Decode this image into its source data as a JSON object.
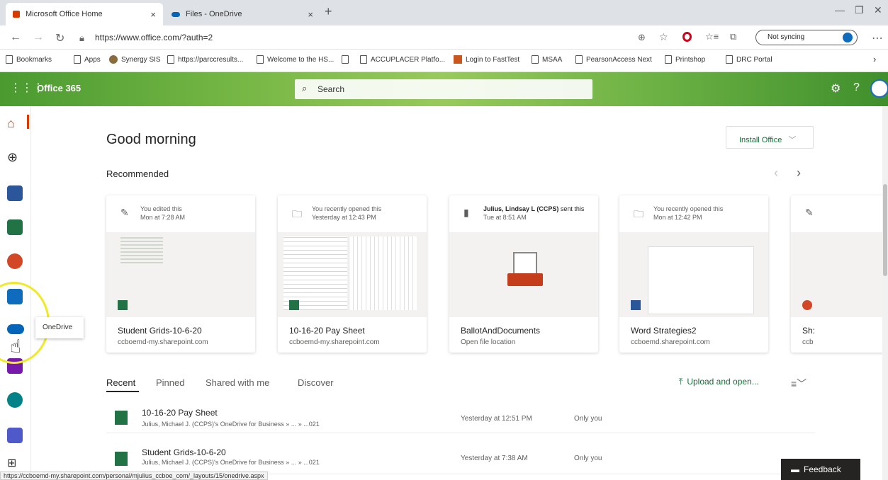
{
  "browser": {
    "tabs": [
      {
        "title": "Microsoft Office Home"
      },
      {
        "title": "Files - OneDrive"
      }
    ],
    "url": "https://www.office.com/?auth=2",
    "sync_label": "Not syncing",
    "bookmarks": [
      "Bookmarks",
      "Apps",
      "Synergy SIS",
      "https://parccresults...",
      "Welcome to the HS...",
      "",
      "ACCUPLACER Platfo...",
      "Login to FastTest",
      "MSAA",
      "PearsonAccess Next",
      "Printshop",
      "DRC Portal"
    ],
    "status_url": "https://ccboemd-my.sharepoint.com/personal/mjulius_ccboe_com/_layouts/15/onedrive.aspx"
  },
  "header": {
    "app_name": "Office 365",
    "search_placeholder": "Search"
  },
  "rail": {
    "tooltip": "OneDrive"
  },
  "main": {
    "greeting": "Good morning",
    "install_label": "Install Office",
    "recommended_label": "Recommended",
    "cards": [
      {
        "line1": "You edited this",
        "line2": "Mon at 7:28 AM",
        "title": "Student Grids-10-6-20",
        "sub": "ccboemd-my.sharepoint.com",
        "app": "excel"
      },
      {
        "line1": "You recently opened this",
        "line2": "Yesterday at 12:43 PM",
        "title": "10-16-20 Pay Sheet",
        "sub": "ccboemd-my.sharepoint.com",
        "app": "excel"
      },
      {
        "line1_bold": "Julius, Lindsay L (CCPS)",
        "line1": " sent this",
        "line2": "Tue at 8:51 AM",
        "title": "BallotAndDocuments",
        "sub": "Open file location",
        "app": "folder"
      },
      {
        "line1": "You recently opened this",
        "line2": "Mon at 12:42 PM",
        "title": "Word Strategies2",
        "sub": "ccboemd.sharepoint.com",
        "app": "word"
      },
      {
        "line1": "",
        "line2": "",
        "title": "Sh:",
        "sub": "ccb",
        "app": "powerpoint"
      }
    ],
    "tabs": [
      "Recent",
      "Pinned",
      "Shared with me",
      "Discover"
    ],
    "upload_label": "Upload and open...",
    "files": [
      {
        "name": "10-16-20 Pay Sheet",
        "path": "Julius, Michael J. (CCPS)'s OneDrive for Business » ... » ...021",
        "time": "Yesterday at 12:51 PM",
        "share": "Only you"
      },
      {
        "name": "Student Grids-10-6-20",
        "path": "Julius, Michael J. (CCPS)'s OneDrive for Business » ... » ...021",
        "time": "Yesterday at 7:38 AM",
        "share": "Only you"
      }
    ],
    "feedback_label": "Feedback"
  },
  "colors": {
    "office_red": "#d83b01",
    "excel_green": "#217346",
    "word_blue": "#2b579a",
    "onedrive_blue": "#0364b8",
    "highlight_yellow": "#f5ef2b"
  }
}
